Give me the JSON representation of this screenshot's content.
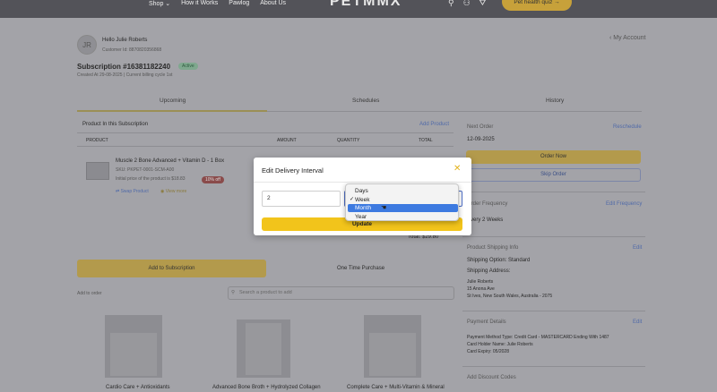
{
  "nav": {
    "items": [
      "Shop ⌄",
      "How it Works",
      "Pawlog",
      "About Us"
    ],
    "logo": "PETMMX",
    "quiz_label": "Pet health quiz →"
  },
  "customer": {
    "initials": "JR",
    "greeting": "Hello Julie Roberts",
    "customer_id": "Customer Id: 8870820356868",
    "my_account": "‹ My Account"
  },
  "subscription": {
    "title": "Subscription #16381182240",
    "status": "Active",
    "created": "Created At 29-08-2025 | Current billing cycle 1st"
  },
  "tabs": [
    "Upcoming",
    "Schedules",
    "History"
  ],
  "products": {
    "section_title": "Product In this Subscription",
    "add_product": "Add Product",
    "columns": [
      "PRODUCT",
      "AMOUNT",
      "QUANTITY",
      "TOTAL"
    ],
    "item": {
      "name": "Muscle 2 Bone Advanced + Vitamin D - 1 Box",
      "sku": "SKU: PKPET-0001-SCM-A00",
      "price": "Initial price of the product is $18.83",
      "discount": "10% off",
      "swap": "Swap Product",
      "view": "View more"
    },
    "total": "Total: $29.80"
  },
  "actions": {
    "add_to_subscription": "Add to Subscription",
    "one_time": "One Time Purchase",
    "add_to_order": "Add to order",
    "search_placeholder": "Search a product to add"
  },
  "catalog": [
    "Cardio Care + Antioxidants",
    "Advanced Bone Broth + Hydrolyzed Collagen",
    "Complete Care + Multi-Vitamin & Mineral"
  ],
  "sidebar": {
    "next_order": "Next Order",
    "reschedule": "Reschedule",
    "next_date": "12-09-2025",
    "order_now": "Order Now",
    "skip_order": "Skip Order",
    "order_frequency": "Order Frequency",
    "edit_frequency": "Edit Frequency",
    "frequency_value": "Every 2 Weeks",
    "shipping_title": "Product Shipping Info",
    "edit": "Edit",
    "shipping_option": "Shipping Option: Standard",
    "address_label": "Shipping Address:",
    "address_lines": [
      "Julie Roberts",
      "15 Anona Ave",
      "St Ives, New South Wales, Australia - 2075"
    ],
    "payment_title": "Payment Details",
    "payment_edit": "Edit",
    "payment_lines": [
      "Payment Method Type: Credit Card - MASTERCARD Ending With 1487",
      "Card Holder Name: Julie Roberts",
      "Card Expiry: 05/2028"
    ],
    "discount_codes": "Add Discount Codes"
  },
  "modal": {
    "title": "Edit Delivery Interval",
    "close": "✕",
    "interval_value": "2",
    "update_label": "Update",
    "options": [
      "Days",
      "Week",
      "Month",
      "Year"
    ],
    "checked_option": "Week",
    "highlighted_option": "Month"
  },
  "colors": {
    "accent_yellow": "#f2c41b",
    "select_blue": "#3d7ae0",
    "overlay": "#a3a3a8"
  }
}
